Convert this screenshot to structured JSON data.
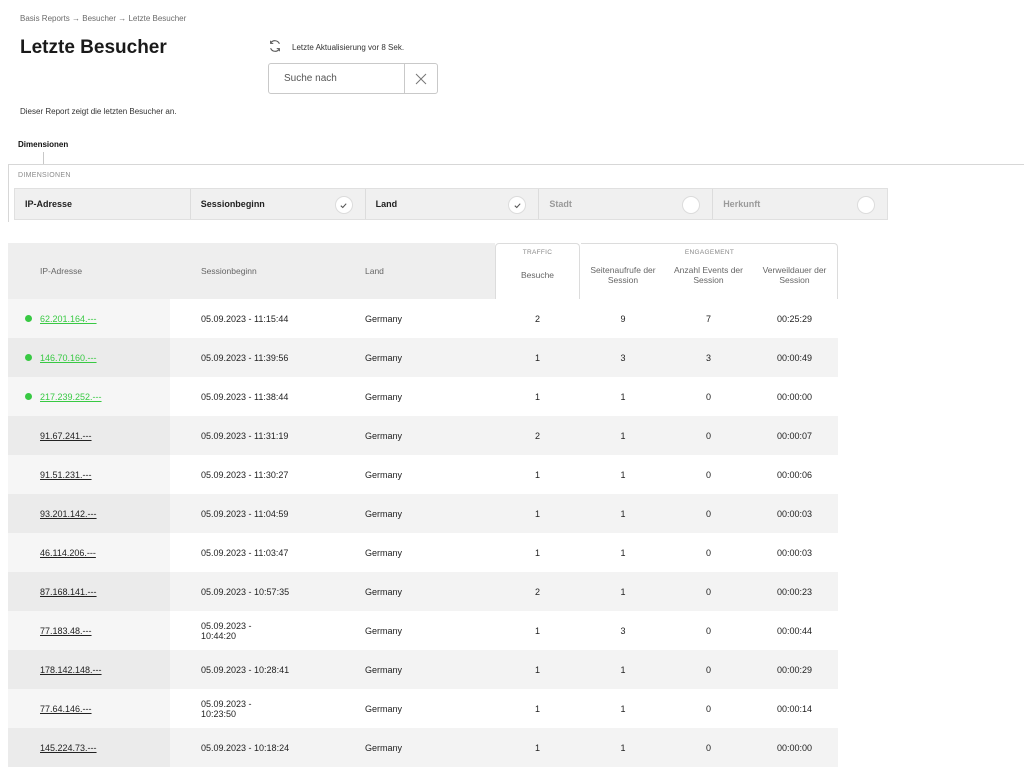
{
  "breadcrumb": "Basis Reports → Besucher → Letzte Besucher",
  "title": "Letzte Besucher",
  "description": "Dieser Report zeigt die letzten Besucher an.",
  "refresh_text": "Letzte Aktualisierung vor 8 Sek.",
  "search": {
    "placeholder": "Suche nach"
  },
  "dimensions": {
    "tab_label": "Dimensionen",
    "caption": "DIMENSIONEN",
    "chips": [
      {
        "label": "IP-Adresse",
        "active": true,
        "toggle": false
      },
      {
        "label": "Sessionbeginn",
        "active": true,
        "toggle": true,
        "checked": true
      },
      {
        "label": "Land",
        "active": true,
        "toggle": true,
        "checked": true
      },
      {
        "label": "Stadt",
        "active": false,
        "toggle": true,
        "checked": false
      },
      {
        "label": "Herkunft",
        "active": false,
        "toggle": true,
        "checked": false
      }
    ]
  },
  "table": {
    "groups": {
      "traffic": "TRAFFIC",
      "engagement": "ENGAGEMENT"
    },
    "headers": {
      "ip": "IP-Adresse",
      "start": "Sessionbeginn",
      "land": "Land",
      "besuche": "Besuche",
      "seitenaufrufe": "Seitenaufrufe der Session",
      "events": "Anzahl Events der Session",
      "verweildauer": "Verweildauer der Session"
    },
    "rows": [
      {
        "ip": "62.201.164.---",
        "live": true,
        "start": "05.09.2023 - 11:15:44",
        "land": "Germany",
        "besuche": "2",
        "seiten": "9",
        "events": "7",
        "dauer": "00:25:29"
      },
      {
        "ip": "146.70.160.---",
        "live": true,
        "start": "05.09.2023 - 11:39:56",
        "land": "Germany",
        "besuche": "1",
        "seiten": "3",
        "events": "3",
        "dauer": "00:00:49"
      },
      {
        "ip": "217.239.252.---",
        "live": true,
        "start": "05.09.2023 - 11:38:44",
        "land": "Germany",
        "besuche": "1",
        "seiten": "1",
        "events": "0",
        "dauer": "00:00:00"
      },
      {
        "ip": "91.67.241.---",
        "live": false,
        "start": "05.09.2023 - 11:31:19",
        "land": "Germany",
        "besuche": "2",
        "seiten": "1",
        "events": "0",
        "dauer": "00:00:07"
      },
      {
        "ip": "91.51.231.---",
        "live": false,
        "start": "05.09.2023 - 11:30:27",
        "land": "Germany",
        "besuche": "1",
        "seiten": "1",
        "events": "0",
        "dauer": "00:00:06"
      },
      {
        "ip": "93.201.142.---",
        "live": false,
        "start": "05.09.2023 - 11:04:59",
        "land": "Germany",
        "besuche": "1",
        "seiten": "1",
        "events": "0",
        "dauer": "00:00:03"
      },
      {
        "ip": "46.114.206.---",
        "live": false,
        "start": "05.09.2023 - 11:03:47",
        "land": "Germany",
        "besuche": "1",
        "seiten": "1",
        "events": "0",
        "dauer": "00:00:03"
      },
      {
        "ip": "87.168.141.---",
        "live": false,
        "start": "05.09.2023 - 10:57:35",
        "land": "Germany",
        "besuche": "2",
        "seiten": "1",
        "events": "0",
        "dauer": "00:00:23"
      },
      {
        "ip": "77.183.48.---",
        "live": false,
        "start": "05.09.2023 - 10:44:20",
        "land": "Germany",
        "besuche": "1",
        "seiten": "3",
        "events": "0",
        "dauer": "00:00:44"
      },
      {
        "ip": "178.142.148.---",
        "live": false,
        "start": "05.09.2023 - 10:28:41",
        "land": "Germany",
        "besuche": "1",
        "seiten": "1",
        "events": "0",
        "dauer": "00:00:29"
      },
      {
        "ip": "77.64.146.---",
        "live": false,
        "start": "05.09.2023 - 10:23:50",
        "land": "Germany",
        "besuche": "1",
        "seiten": "1",
        "events": "0",
        "dauer": "00:00:14"
      },
      {
        "ip": "145.224.73.---",
        "live": false,
        "start": "05.09.2023 - 10:18:24",
        "land": "Germany",
        "besuche": "1",
        "seiten": "1",
        "events": "0",
        "dauer": "00:00:00"
      }
    ]
  },
  "colors": {
    "live": "#38c943"
  }
}
